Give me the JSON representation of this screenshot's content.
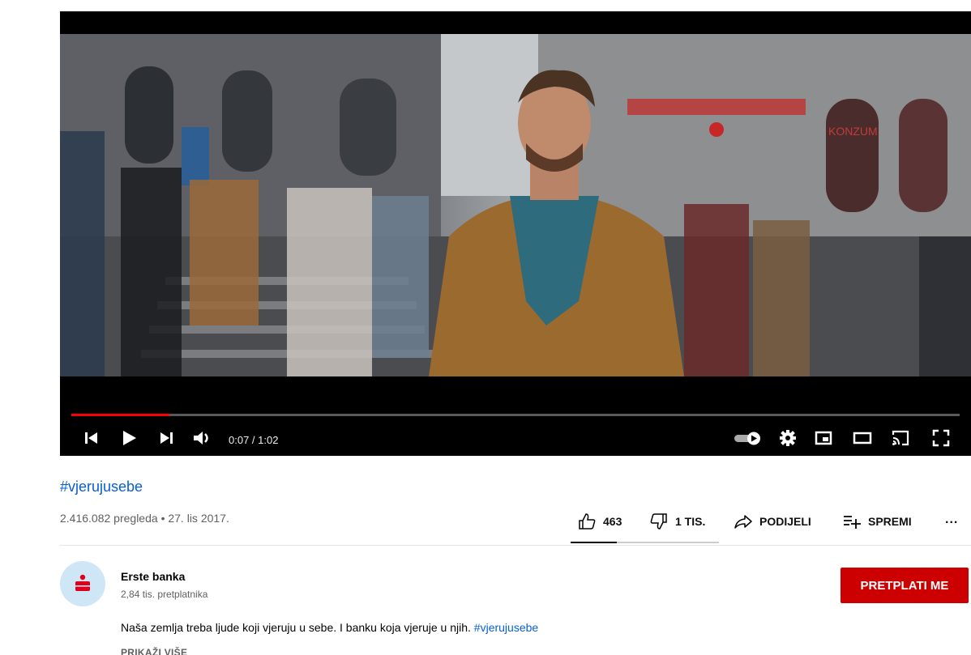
{
  "player": {
    "time_label": "0:07 / 1:02",
    "progress_fraction": 0.11,
    "buffered_fraction": 0.11,
    "accent_color": "#ff0000",
    "controls": [
      "previous-icon",
      "play-icon",
      "next-icon",
      "volume-icon",
      "autoplay-toggle-icon",
      "settings-gear-icon",
      "miniplayer-icon",
      "theater-mode-icon",
      "cast-icon",
      "fullscreen-icon"
    ],
    "frame_signage": "KONZUM"
  },
  "video": {
    "title": "#vjerujusebe",
    "views": "2.416.082 pregleda",
    "separator": "•",
    "date": "27. lis 2017."
  },
  "actions": {
    "like_count": "463",
    "dislike_count": "1 TIS.",
    "share_label": "PODIJELI",
    "save_label": "SPREMI",
    "more_label": "...",
    "like_ratio": 0.31
  },
  "channel": {
    "name": "Erste banka",
    "subscribers": "2,84 tis. pretplatnika",
    "subscribe_label": "PRETPLATI ME",
    "subscribe_color": "#cc0000",
    "avatar_bg": "#cfe6f7",
    "logo_color": "#e1001a"
  },
  "description": {
    "text": "Naša zemlja treba ljude koji vjeruju u sebe. I banku koja vjeruje u njih.",
    "hashtag": "#vjerujusebe",
    "show_more": "PRIKAŽI VIŠE"
  }
}
